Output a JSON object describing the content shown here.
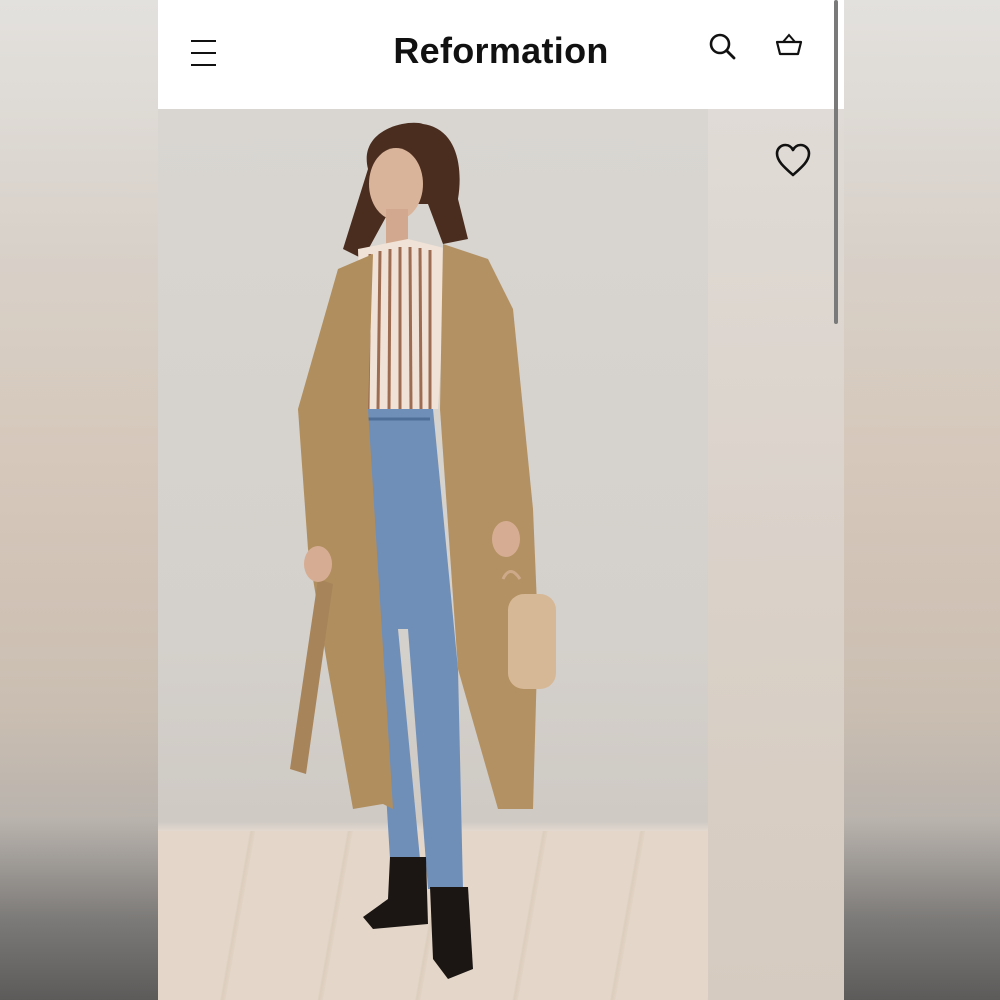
{
  "header": {
    "brand": "Reformation",
    "menu_icon": "hamburger-menu-icon",
    "search_icon": "search-icon",
    "bag_icon": "shopping-basket-icon"
  },
  "product": {
    "favorite_icon": "heart-outline-icon"
  },
  "colors": {
    "header_bg": "#ffffff",
    "text": "#111111",
    "coat": "#b08e5e",
    "denim": "#6f8fb8"
  }
}
